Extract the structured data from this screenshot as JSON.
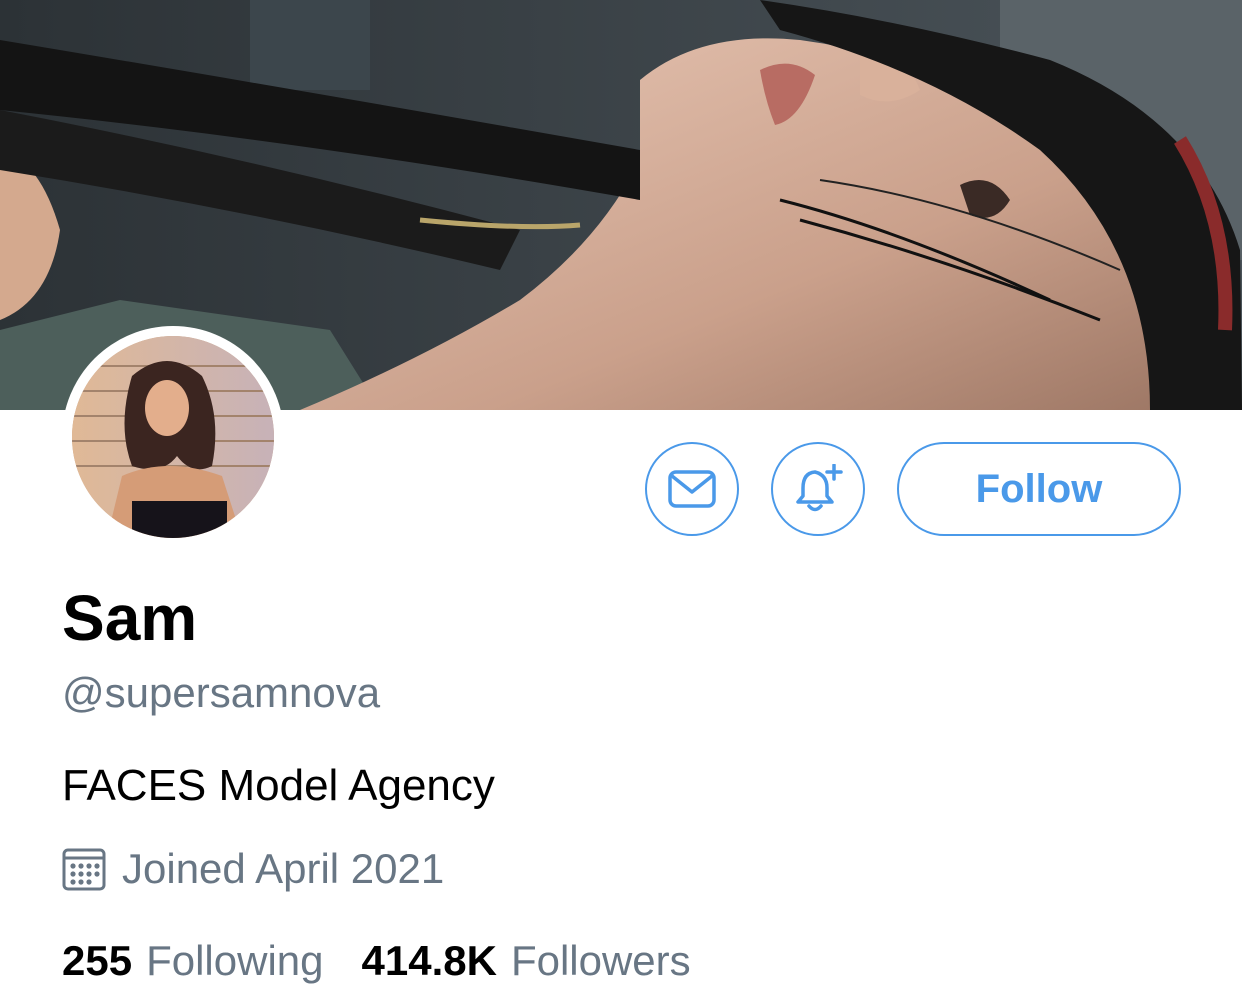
{
  "profile": {
    "name": "Sam",
    "handle": "@supersamnova",
    "bio": "FACES Model Agency",
    "joined": "Joined April 2021"
  },
  "actions": {
    "follow_label": "Follow",
    "message_icon": "envelope-icon",
    "notify_icon": "bell-plus-icon"
  },
  "stats": {
    "following_count": "255",
    "following_label": "Following",
    "followers_count": "414.8K",
    "followers_label": "Followers"
  },
  "colors": {
    "accent": "#4a99e9",
    "secondary_text": "#687684",
    "primary_text": "#000000"
  }
}
